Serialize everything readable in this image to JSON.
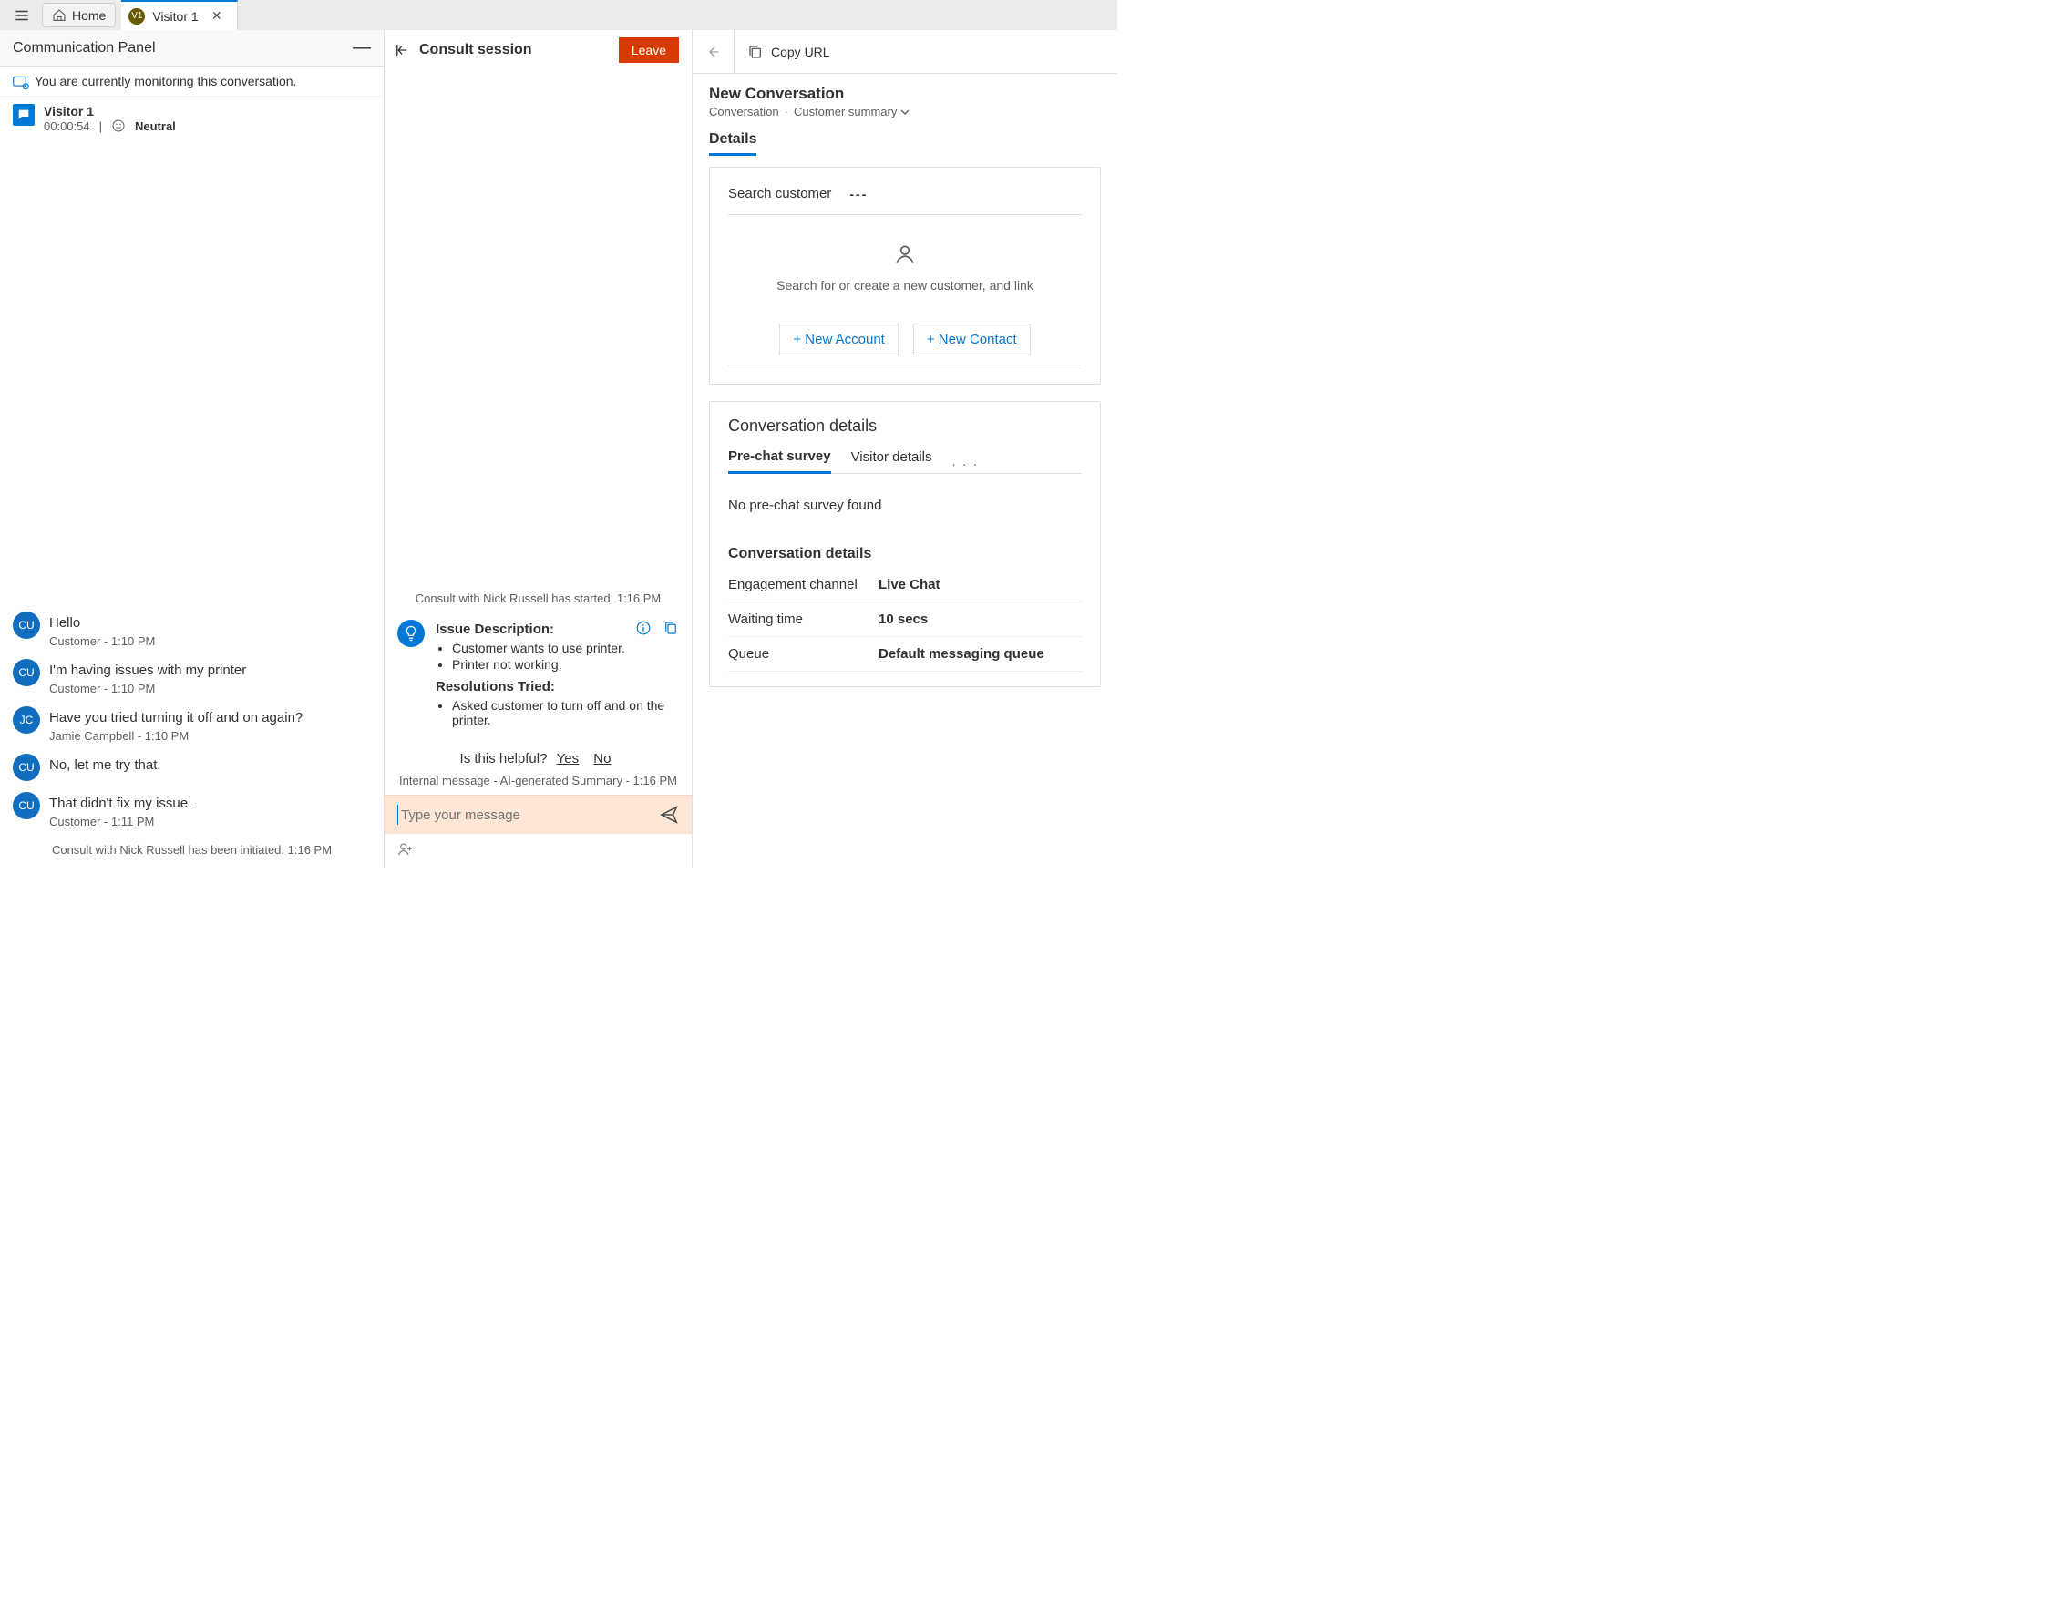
{
  "topbar": {
    "home_label": "Home",
    "tab_badge": "V1",
    "tab_label": "Visitor 1"
  },
  "comm": {
    "title": "Communication Panel",
    "monitor_text": "You are currently monitoring this conversation.",
    "session": {
      "title": "Visitor 1",
      "timer": "00:00:54",
      "sentiment": "Neutral"
    }
  },
  "transcript": [
    {
      "avatar": "CU",
      "text": "Hello",
      "meta": "Customer - 1:10 PM"
    },
    {
      "avatar": "CU",
      "text": "I'm having issues with my printer",
      "meta": "Customer - 1:10 PM"
    },
    {
      "avatar": "JC",
      "text": "Have you tried turning it off and on again?",
      "meta": "Jamie Campbell - 1:10 PM"
    },
    {
      "avatar": "CU",
      "text": "No, let me try that.",
      "meta": ""
    },
    {
      "avatar": "CU",
      "text": "That didn't fix my issue.",
      "meta": "Customer - 1:11 PM"
    }
  ],
  "transcript_system": "Consult with Nick Russell has been initiated. 1:16 PM",
  "consult": {
    "title": "Consult session",
    "leave": "Leave",
    "started": "Consult with Nick Russell has started. 1:16 PM",
    "issue_title": "Issue Description:",
    "issues": [
      "Customer wants to use printer.",
      "Printer not working."
    ],
    "res_title": "Resolutions Tried:",
    "resolutions": [
      "Asked customer to turn off and on the printer."
    ],
    "helpful_q": "Is this helpful?",
    "yes": "Yes",
    "no": "No",
    "internal_meta": "Internal message - AI-generated Summary - 1:16 PM",
    "compose_placeholder": "Type your message"
  },
  "details": {
    "copy_url": "Copy URL",
    "heading": "New Conversation",
    "crumb_entity": "Conversation",
    "crumb_view": "Customer summary",
    "tab_details": "Details",
    "search_label": "Search customer",
    "search_value": "---",
    "empty_text": "Search for or create a new customer, and link",
    "new_account": "+ New Account",
    "new_contact": "+ New Contact",
    "conv_title": "Conversation details",
    "tabs": {
      "prechat": "Pre-chat survey",
      "visitor": "Visitor details"
    },
    "no_survey": "No pre-chat survey found",
    "conv_sub": "Conversation details",
    "kv": [
      {
        "k": "Engagement channel",
        "v": "Live Chat"
      },
      {
        "k": "Waiting time",
        "v": "10 secs"
      },
      {
        "k": "Queue",
        "v": "Default messaging queue"
      }
    ]
  }
}
